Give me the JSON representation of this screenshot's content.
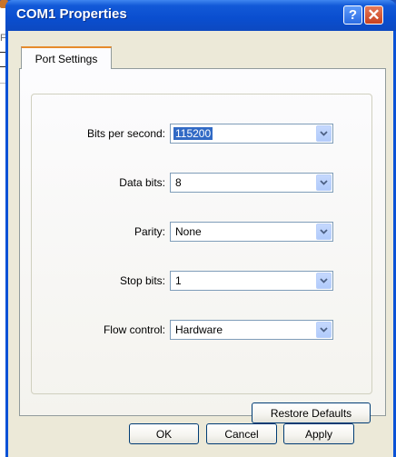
{
  "window": {
    "title": "COM1 Properties",
    "help_label": "?",
    "close_label": "✕"
  },
  "background": {
    "letter": "F"
  },
  "tabs": [
    {
      "label": "Port Settings",
      "active": true
    }
  ],
  "fields": [
    {
      "label": "Bits per second:",
      "value": "115200",
      "selected": true
    },
    {
      "label": "Data bits:",
      "value": "8",
      "selected": false
    },
    {
      "label": "Parity:",
      "value": "None",
      "selected": false
    },
    {
      "label": "Stop bits:",
      "value": "1",
      "selected": false
    },
    {
      "label": "Flow control:",
      "value": "Hardware",
      "selected": false
    }
  ],
  "buttons": {
    "restore_defaults": "Restore Defaults",
    "ok": "OK",
    "cancel": "Cancel",
    "apply": "Apply"
  },
  "colors": {
    "titlebar": "#0a4ecf",
    "dialog_face": "#ece9d8",
    "selection": "#316ac5",
    "tab_accent": "#e68b2c"
  }
}
